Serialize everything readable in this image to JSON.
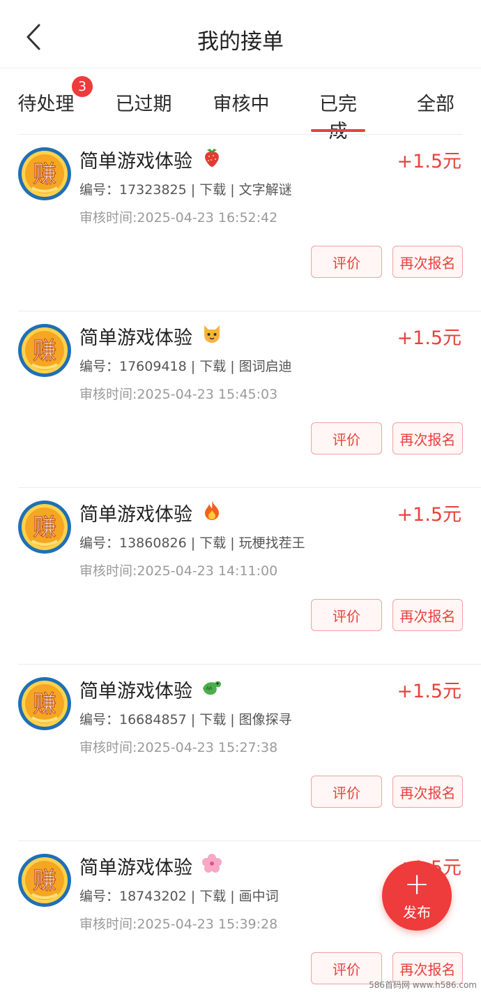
{
  "header": {
    "title": "我的接单"
  },
  "tabs": [
    {
      "label": "待处理",
      "badge": "3"
    },
    {
      "label": "已过期"
    },
    {
      "label": "审核中"
    },
    {
      "label": "已完成",
      "active": true
    },
    {
      "label": "全部"
    }
  ],
  "avatar_glyph": "赚",
  "items": [
    {
      "title": "简单游戏体验",
      "emoji": "strawberry-icon",
      "reward": "+1.5元",
      "meta": "编号：17323825 | 下载 | 文字解谜",
      "review_time": "审核时间:2025-04-23 16:52:42",
      "btn_review": "评价",
      "btn_rejoin": "再次报名"
    },
    {
      "title": "简单游戏体验",
      "emoji": "cat-icon",
      "reward": "+1.5元",
      "meta": "编号：17609418 | 下载 | 图词启迪",
      "review_time": "审核时间:2025-04-23 15:45:03",
      "btn_review": "评价",
      "btn_rejoin": "再次报名"
    },
    {
      "title": "简单游戏体验",
      "emoji": "fire-icon",
      "reward": "+1.5元",
      "meta": "编号：13860826 | 下载 | 玩梗找茬王",
      "review_time": "审核时间:2025-04-23 14:11:00",
      "btn_review": "评价",
      "btn_rejoin": "再次报名"
    },
    {
      "title": "简单游戏体验",
      "emoji": "dragon-icon",
      "reward": "+1.5元",
      "meta": "编号：16684857 | 下载 | 图像探寻",
      "review_time": "审核时间:2025-04-23 15:27:38",
      "btn_review": "评价",
      "btn_rejoin": "再次报名"
    },
    {
      "title": "简单游戏体验",
      "emoji": "flower-icon",
      "reward": "+1.5元",
      "meta": "编号：18743202 | 下载 | 画中词",
      "review_time": "审核时间:2025-04-23 15:39:28",
      "btn_review": "评价",
      "btn_rejoin": "再次报名"
    }
  ],
  "fab": {
    "plus": "+",
    "label": "发布"
  },
  "watermark": "586首码网 www.h586.com",
  "colors": {
    "accent": "#e8413b",
    "fab": "#ee3b3b",
    "coin": "#f5a623",
    "coin_ring": "#1f6fb5"
  }
}
